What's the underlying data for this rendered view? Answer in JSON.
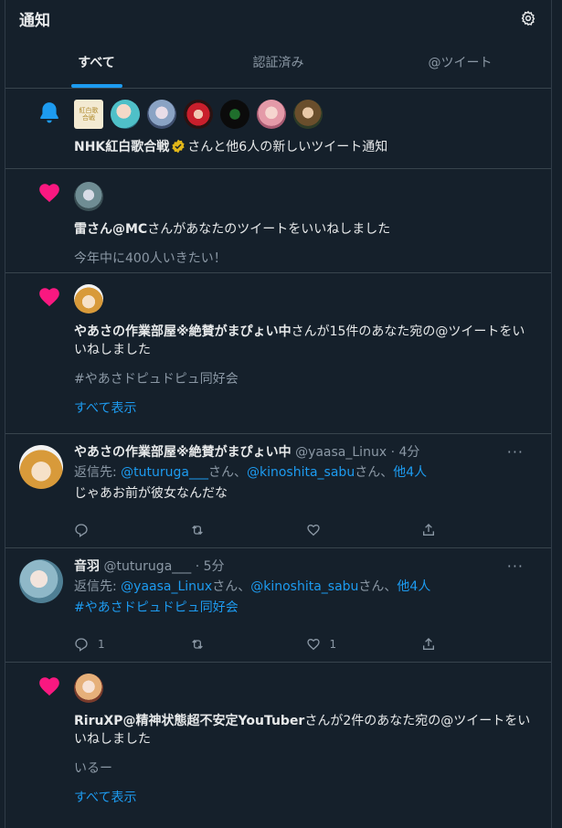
{
  "header": {
    "title": "通知"
  },
  "tabs": [
    {
      "label": "すべて",
      "active": true
    },
    {
      "label": "認証済み",
      "active": false
    },
    {
      "label": "@ツイート",
      "active": false
    }
  ],
  "colors": {
    "accent": "#1d9bf0",
    "like": "#f91880",
    "background": "#15202b",
    "verified": "#e2b719"
  },
  "n1": {
    "icon": "bell-icon",
    "bold": "NHK紅白歌合戦",
    "rest": "さんと他6人の新しいツイート通知",
    "avatar_text": "紅白歌合戦"
  },
  "n2": {
    "icon": "heart-icon",
    "bold": "雷さん@MC",
    "rest": "さんがあなたのツイートをいいねしました",
    "quote": "今年中に400人いきたい！"
  },
  "n3": {
    "icon": "heart-icon",
    "bold": "やあさの作業部屋※絶賛がまぴょい中",
    "rest": "さんが15件のあなた宛の@ツイートをいいねしました",
    "quote": "#やあさドピュドピュ同好会",
    "show_all": "すべて表示"
  },
  "t1": {
    "name": "やあさの作業部屋※絶賛がまぴょい中",
    "handle": "@yaasa_Linux",
    "time": "· 4分",
    "reply_prefix": "返信先: ",
    "reply_user1": "@tuturuga___",
    "sep1": "さん、",
    "reply_user2": "@kinoshita_sabu",
    "sep2": "さん、",
    "reply_more": "他4人",
    "text": "じゃあお前が彼女なんだな",
    "reply_count": "",
    "retweet_count": "",
    "like_count": ""
  },
  "t2": {
    "name": "音羽",
    "handle": "@tuturuga___",
    "time": "· 5分",
    "reply_prefix": "返信先: ",
    "reply_user1": "@yaasa_Linux",
    "sep1": "さん、",
    "reply_user2": "@kinoshita_sabu",
    "sep2": "さん、",
    "reply_more": "他4人",
    "text": "#やあさドピュドピュ同好会",
    "reply_count": "1",
    "retweet_count": "",
    "like_count": "1"
  },
  "n4": {
    "icon": "heart-icon",
    "bold": "RiruXP@精神状態超不安定YouTuber",
    "rest": "さんが2件のあなた宛の@ツイートをいいねしました",
    "quote": "いるー",
    "show_all": "すべて表示"
  }
}
